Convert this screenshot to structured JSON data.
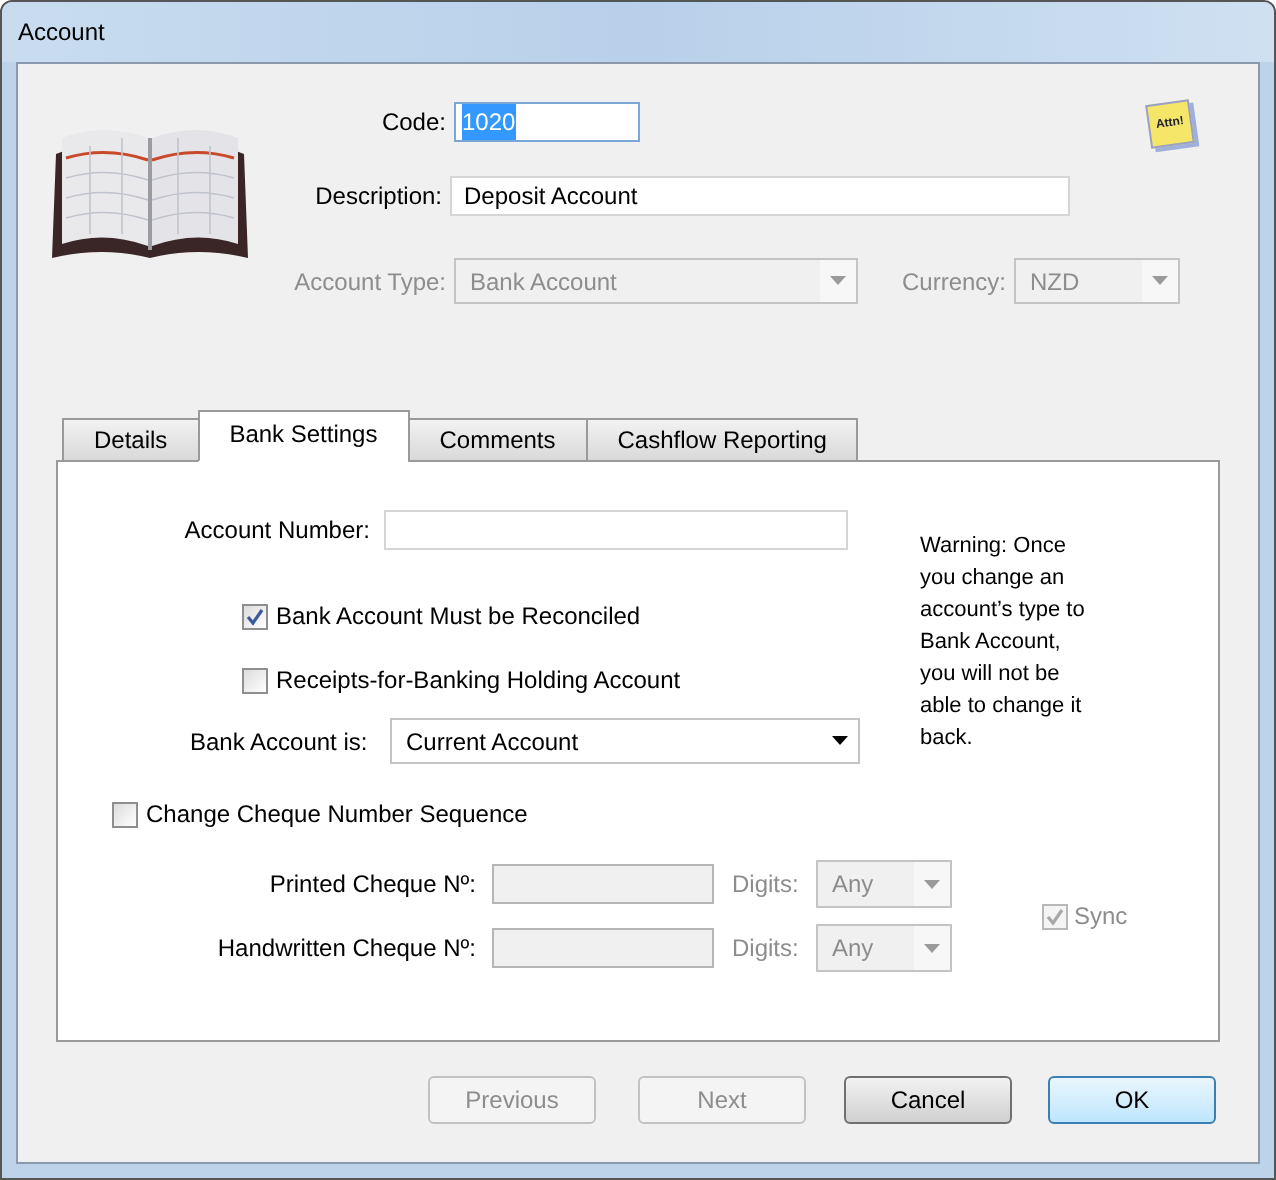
{
  "window": {
    "title": "Account"
  },
  "header": {
    "note_text": "Attn!",
    "code": {
      "label": "Code:",
      "value": "1020",
      "text_selected": true
    },
    "description": {
      "label": "Description:",
      "value": "Deposit Account"
    },
    "account_type": {
      "label": "Account Type:",
      "value": "Bank Account",
      "disabled": true
    },
    "currency": {
      "label": "Currency:",
      "value": "NZD",
      "disabled": true
    }
  },
  "tabs": [
    {
      "label": "Details",
      "selected": false
    },
    {
      "label": "Bank Settings",
      "selected": true
    },
    {
      "label": "Comments",
      "selected": false
    },
    {
      "label": "Cashflow Reporting",
      "selected": false
    }
  ],
  "bank_settings": {
    "account_number": {
      "label": "Account Number:"
    },
    "checkboxes": [
      {
        "label": "Bank Account Must be Reconciled",
        "checked": true
      },
      {
        "label": "Receipts-for-Banking Holding Account",
        "checked": false
      }
    ],
    "bank_account_is": {
      "label": "Bank Account is:",
      "value": "Current Account",
      "disabled": false
    },
    "warning": "Warning: Once you change an account’s type to Bank Account, you will not be able to change it back.",
    "change_cheque": {
      "label": "Change Cheque Number Sequence",
      "checked": false
    },
    "cheque_rows": [
      {
        "label": "Printed Cheque Nº:",
        "digits_label": "Digits:",
        "digits_value": "Any",
        "disabled": true
      },
      {
        "label": "Handwritten Cheque Nº:",
        "digits_label": "Digits:",
        "digits_value": "Any",
        "disabled": true
      }
    ],
    "sync": {
      "label": "Sync",
      "checked": true,
      "disabled": true
    }
  },
  "buttons": [
    {
      "label": "Previous",
      "disabled": true,
      "default": false
    },
    {
      "label": "Next",
      "disabled": true,
      "default": false
    },
    {
      "label": "Cancel",
      "disabled": false,
      "default": false
    },
    {
      "label": "OK",
      "disabled": false,
      "default": true
    }
  ]
}
